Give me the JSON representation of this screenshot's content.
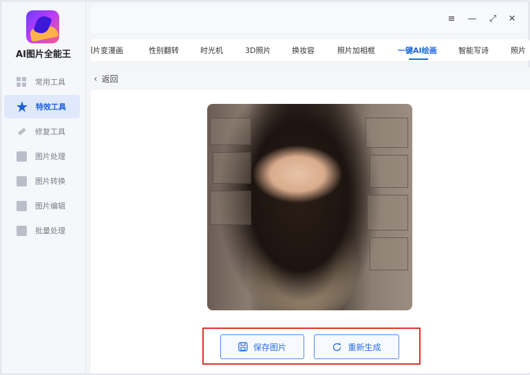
{
  "app": {
    "title": "AI图片全能王"
  },
  "sidebar": {
    "items": [
      {
        "label": "常用工具",
        "icon": "grid-icon",
        "active": false
      },
      {
        "label": "特效工具",
        "icon": "star-icon",
        "active": true
      },
      {
        "label": "修复工具",
        "icon": "bandage-icon",
        "active": false
      },
      {
        "label": "图片处理",
        "icon": "image-icon",
        "active": false
      },
      {
        "label": "图片转换",
        "icon": "convert-icon",
        "active": false
      },
      {
        "label": "图片编辑",
        "icon": "edit-icon",
        "active": false
      },
      {
        "label": "批量处理",
        "icon": "upload-icon",
        "active": false
      }
    ]
  },
  "window_controls": {
    "menu": "≡",
    "minimize": "—",
    "maximize": "⤢",
    "close": "✕"
  },
  "tabs": [
    {
      "label": "照片变漫画",
      "active": false
    },
    {
      "label": "性别翻转",
      "active": false
    },
    {
      "label": "时光机",
      "active": false
    },
    {
      "label": "3D照片",
      "active": false
    },
    {
      "label": "换妆容",
      "active": false
    },
    {
      "label": "照片加相框",
      "active": false
    },
    {
      "label": "一键AI绘画",
      "active": true
    },
    {
      "label": "智能写诗",
      "active": false
    },
    {
      "label": "照片",
      "active": false
    }
  ],
  "content": {
    "back_label": "返回",
    "save_label": "保存图片",
    "regenerate_label": "重新生成"
  },
  "colors": {
    "accent": "#1a66e0",
    "highlight_frame": "#d9332c"
  }
}
